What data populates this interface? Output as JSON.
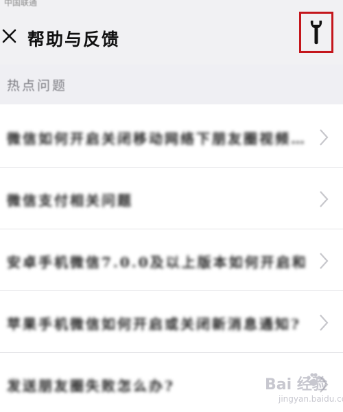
{
  "status_bar": {
    "text": "中国联通"
  },
  "header": {
    "title": "帮助与反馈"
  },
  "section": {
    "title": "热点问题"
  },
  "faq_items": [
    {
      "label": "微信如何开启关闭移动网络下朋友圈视频…"
    },
    {
      "label": "微信支付相关问题"
    },
    {
      "label": "安卓手机微信7.0.0及以上版本如何开启和…"
    },
    {
      "label": "苹果手机微信如何开启或关闭新消息通知?"
    },
    {
      "label": "发送朋友圈失败怎么办?"
    }
  ],
  "watermark": {
    "logo": "Bai 经验",
    "sub": "jingyan.baidu.com"
  },
  "colors": {
    "header_bg": "#f1f1f3",
    "highlight_border": "#c4161c",
    "section_text": "#7e7e84",
    "chevron": "#c7c7cc"
  },
  "icons": {
    "close": "close-icon",
    "settings": "wrench-icon",
    "item_arrow": "chevron-right-icon"
  }
}
